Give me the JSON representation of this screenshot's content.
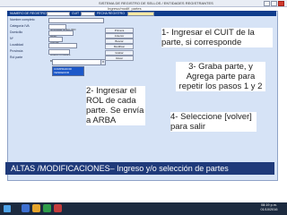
{
  "window": {
    "title": "SISTEMA DE REGISTRO DE SELLOS / ENTIDADES REGISTRANTES",
    "subtitle": "Ingreso/modif. partes"
  },
  "header": {
    "label_cuit": "NUMERO DE REGISTRO",
    "label_cuit2": "CUIT",
    "label_fecha": "FECHA REGISTRO",
    "cuit_value": "",
    "fecha_value": ""
  },
  "form": {
    "fields": [
      {
        "label": "Nombre completo",
        "value": "NOMBRE APELLIDO"
      },
      {
        "label": "Categoría IVA",
        "value": "Resp."
      },
      {
        "label": "Domicilio",
        "value": "CALLE"
      },
      {
        "label": "Nº",
        "value": ""
      },
      {
        "label": "Localidad",
        "value": "BUENOS AIRES"
      },
      {
        "label": "Provincia",
        "value": "BS. AS."
      },
      {
        "label": "Rol parte",
        "value": "ROL"
      }
    ],
    "rol_combo": {
      "value": "COMPRADOR"
    },
    "rol_options": [
      "COMPRADOR",
      "VENDEDOR"
    ],
    "buttons": [
      "Primera",
      "Anterior",
      "Buscar",
      "Modificar",
      "Grabar",
      "Volver"
    ]
  },
  "callouts": {
    "c1": "1- Ingresar el CUIT de la parte, si corresponde",
    "c2": "2- Ingresar el ROL de cada parte. Se envía a ARBA",
    "c3": "3- Graba parte, y Agrega parte para repetir los pasos 1 y 2",
    "c4": "4- Seleccione [volver] para salir"
  },
  "banner": "ALTAS /MODIFICACIONES– Ingreso y/o selección de partes",
  "taskbar": {
    "time": "08:19 p.m.",
    "date": "01/10/2016"
  },
  "colors": {
    "header": "#0e3c8c",
    "form_bg": "#d6e3f6",
    "banner": "#1f3a7a",
    "taskbar": "#1c2a3f",
    "listbox": "#1c58c9"
  }
}
